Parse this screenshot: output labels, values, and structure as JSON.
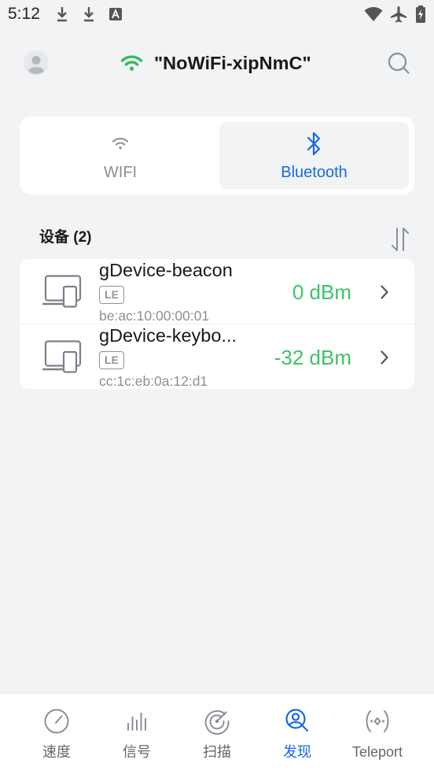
{
  "status_bar": {
    "time": "5:12",
    "icons": [
      "download-icon",
      "download-icon",
      "font-a-icon",
      "wifi-icon",
      "airplane-icon",
      "battery-charging-icon"
    ]
  },
  "header": {
    "avatar_icon": "person-icon",
    "wifi_icon": "wifi-icon",
    "network_name": "\"NoWiFi-xipNmC\"",
    "search_icon": "search-icon"
  },
  "tabs": [
    {
      "label": "WIFI",
      "icon": "wifi-icon",
      "selected": false
    },
    {
      "label": "Bluetooth",
      "icon": "bluetooth-icon",
      "selected": true
    }
  ],
  "devices_section": {
    "title": "设备 (2)",
    "sort_icon": "sort-icon"
  },
  "devices": [
    {
      "name": "gDevice-beacon",
      "type_badge": "LE",
      "mac": "be:ac:10:00:00:01",
      "rssi": "0 dBm",
      "icon": "devices-icon"
    },
    {
      "name": "gDevice-keybo...",
      "type_badge": "LE",
      "mac": "cc:1c:eb:0a:12:d1",
      "rssi": "-32 dBm",
      "icon": "devices-icon"
    }
  ],
  "bottom_nav": [
    {
      "label": "速度",
      "icon": "speedometer-icon",
      "selected": false
    },
    {
      "label": "信号",
      "icon": "signal-bars-icon",
      "selected": false
    },
    {
      "label": "扫描",
      "icon": "radar-icon",
      "selected": false
    },
    {
      "label": "发现",
      "icon": "discover-icon",
      "selected": true
    },
    {
      "label": "Teleport",
      "icon": "teleport-icon",
      "selected": false
    }
  ],
  "colors": {
    "background": "#f2f3f5",
    "accent": "#1769e0",
    "signal_green": "#3cc36a",
    "wifi_green": "#2dbd5a",
    "text": "#1a1a1a",
    "muted": "#8a8f99"
  }
}
